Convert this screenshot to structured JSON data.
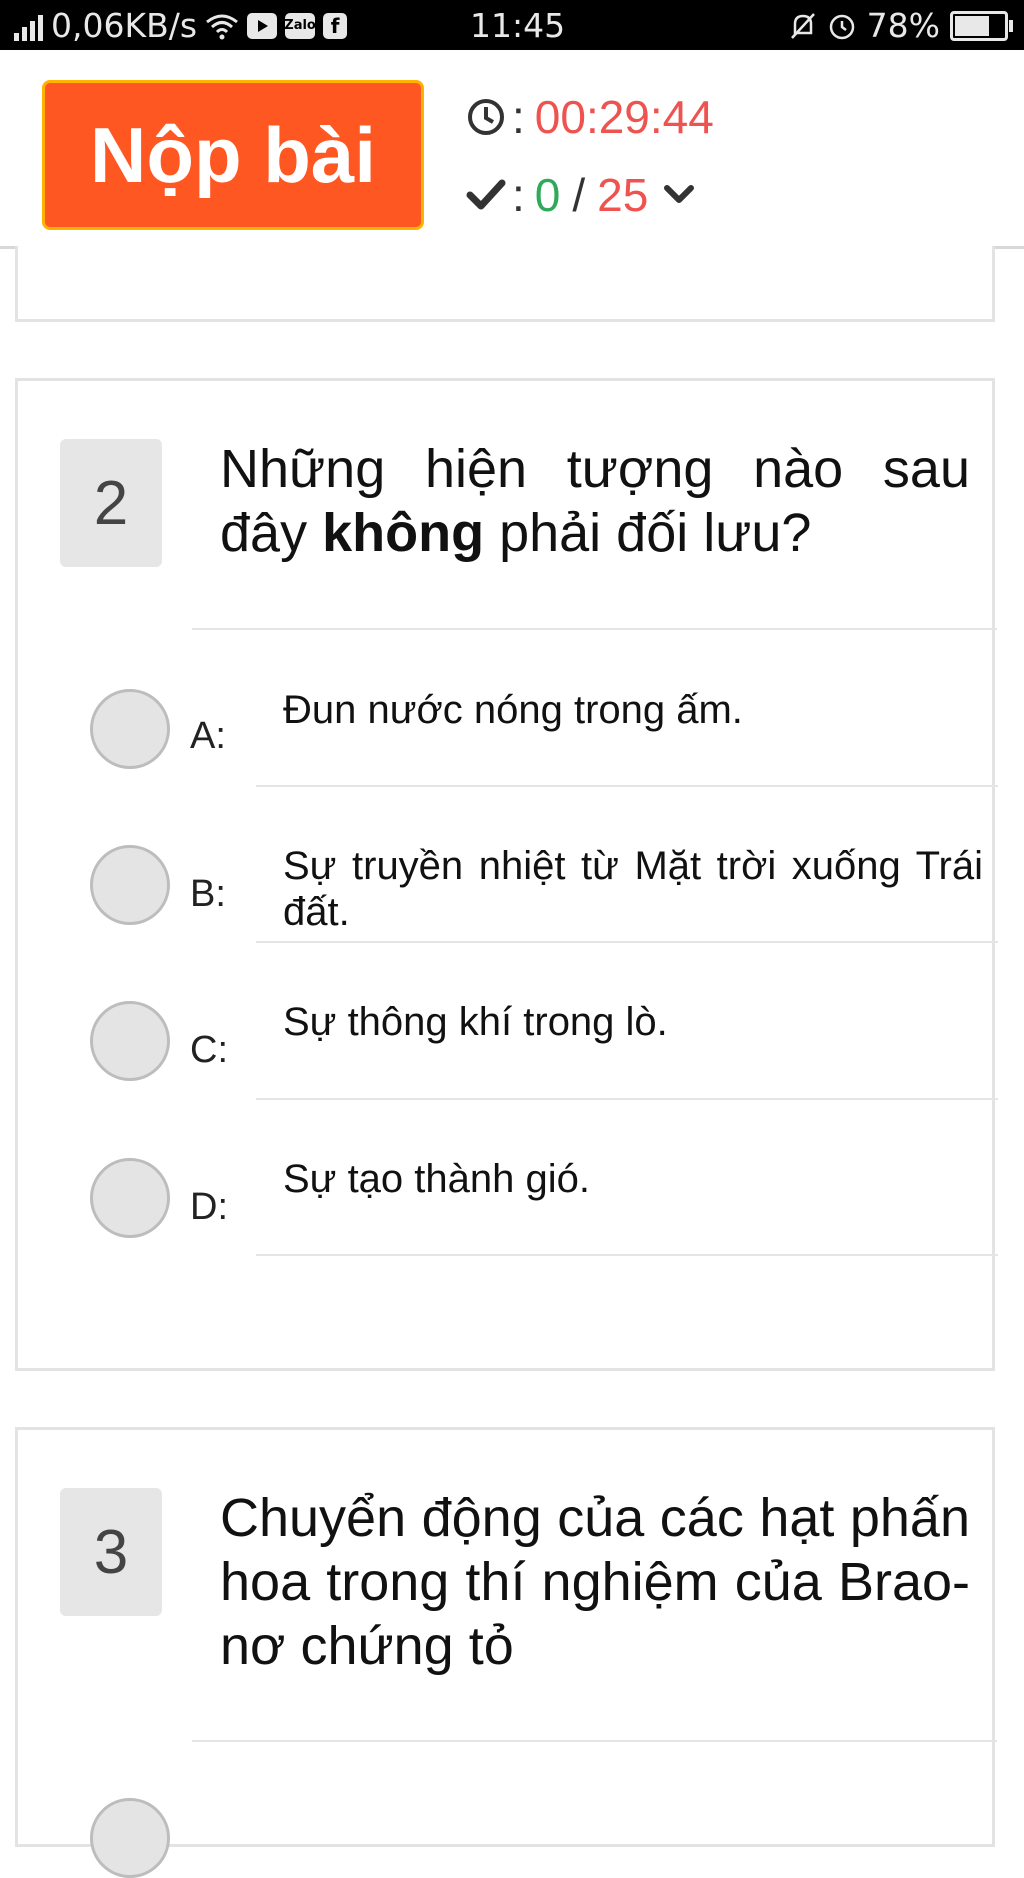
{
  "status_bar": {
    "network_speed": "0,06KB/s",
    "time": "11:45",
    "battery": "78%",
    "battery_level": 0.78,
    "icons": [
      "signal-icon",
      "wifi-icon",
      "youtube-icon",
      "zalo-icon",
      "facebook-icon",
      "mute-icon",
      "alarm-icon",
      "battery-icon"
    ],
    "zalo_label": "Zalo",
    "facebook_label": "f"
  },
  "header": {
    "submit_label": "Nộp bài",
    "timer_value": "00:29:44",
    "answered_count": "0",
    "total_count": "25",
    "separator": ":",
    "slash": "/",
    "colors": {
      "submit_bg": "#ff5722",
      "timer": "#ef5350",
      "answered": "#2eaa5a",
      "total": "#ef5350"
    }
  },
  "questions": [
    {
      "number": "2",
      "text_before": "Những hiện tượng nào sau đây ",
      "text_bold": "không",
      "text_after": " phải đối lưu?",
      "options": [
        {
          "letter": "A:",
          "text": "Đun nước nóng trong ấm."
        },
        {
          "letter": "B:",
          "text": "Sự truyền nhiệt từ Mặt trời xuống Trái đất."
        },
        {
          "letter": "C:",
          "text": "Sự thông khí trong lò."
        },
        {
          "letter": "D:",
          "text": "Sự tạo thành gió."
        }
      ]
    },
    {
      "number": "3",
      "text": "Chuyển động của các hạt phấn hoa trong thí nghiệm của Brao-nơ chứng tỏ"
    }
  ]
}
